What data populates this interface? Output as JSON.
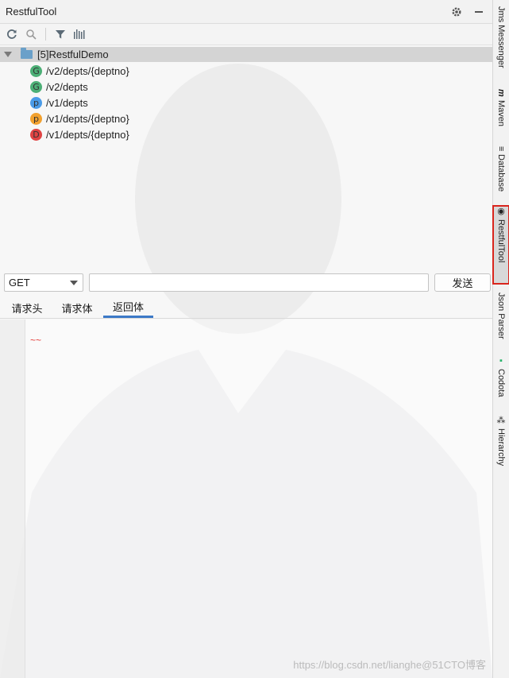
{
  "window": {
    "title": "RestfulTool"
  },
  "header_icons": {
    "settings": "gear-icon",
    "minimize": "minimize-icon"
  },
  "toolbar": {
    "items": [
      "refresh-icon",
      "search-icon",
      "filter-icon",
      "barcode-icon"
    ]
  },
  "tree": {
    "root_label": "[5]RestfulDemo",
    "items": [
      {
        "method": "G",
        "path": "/v2/depts/{deptno}",
        "color": "#4caf76"
      },
      {
        "method": "G",
        "path": "/v2/depts",
        "color": "#4caf76"
      },
      {
        "method": "p",
        "path": "/v1/depts",
        "color": "#4a9be8"
      },
      {
        "method": "p",
        "path": "/v1/depts/{deptno}",
        "color": "#f2a12f"
      },
      {
        "method": "D",
        "path": "/v1/depts/{deptno}",
        "color": "#e04343"
      }
    ]
  },
  "request": {
    "method": "GET",
    "url_value": "",
    "send_label": "发送"
  },
  "tabs": [
    {
      "label": "请求头",
      "active": false
    },
    {
      "label": "请求体",
      "active": false
    },
    {
      "label": "返回体",
      "active": true
    }
  ],
  "editor": {
    "squiggle": "~~"
  },
  "side_tools": [
    {
      "label": "Jms Messenger",
      "icon": ""
    },
    {
      "label": "Maven",
      "icon": "m"
    },
    {
      "label": "Database",
      "icon": "≡"
    },
    {
      "label": "RestfulTool",
      "icon": "◉",
      "active": true
    },
    {
      "label": "Json Parser",
      "icon": ""
    },
    {
      "label": "Codota",
      "icon": "▪"
    },
    {
      "label": "Hierarchy",
      "icon": "⁂"
    }
  ],
  "watermark": "https://blog.csdn.net/lianghe@51CTO博客",
  "colors": {
    "accent": "#3c79c7",
    "highlight_border": "#d9251d"
  }
}
